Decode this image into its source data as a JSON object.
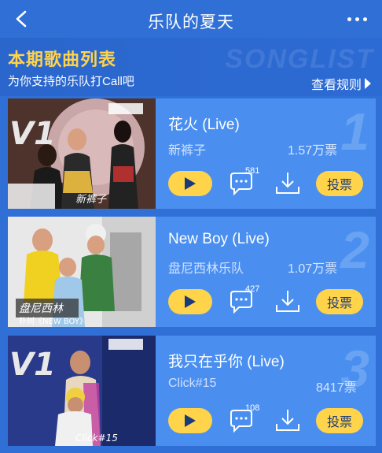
{
  "header": {
    "title": "乐队的夏天"
  },
  "intro": {
    "title": "本期歌曲列表",
    "subtitle": "为你支持的乐队打Call吧",
    "watermark": "SONGLIST",
    "rules_link": "查看规则"
  },
  "songs": [
    {
      "rank": "1",
      "title": "花火 (Live)",
      "band": "新裤子",
      "votes": "1.57万票",
      "comments": "581",
      "vote_label": "投票",
      "badge": "V1",
      "photo_caption": "新裤子"
    },
    {
      "rank": "2",
      "title": "New Boy (Live)",
      "band": "盘尼西林乐队",
      "votes": "1.07万票",
      "comments": "427",
      "vote_label": "投票",
      "badge": "",
      "photo_caption": "盘尼西林",
      "photo_subcaption": "朴树《NEW BOY》"
    },
    {
      "rank": "3",
      "title": "我只在乎你 (Live)",
      "band": "Click#15",
      "votes": "8417票",
      "comments": "108",
      "vote_label": "投票",
      "badge": "V1",
      "photo_caption": "Click#15"
    }
  ],
  "colors": {
    "page_bg": "#2f6fd6",
    "card_bg": "#4a8ff0",
    "accent_yellow": "#ffd34a"
  }
}
